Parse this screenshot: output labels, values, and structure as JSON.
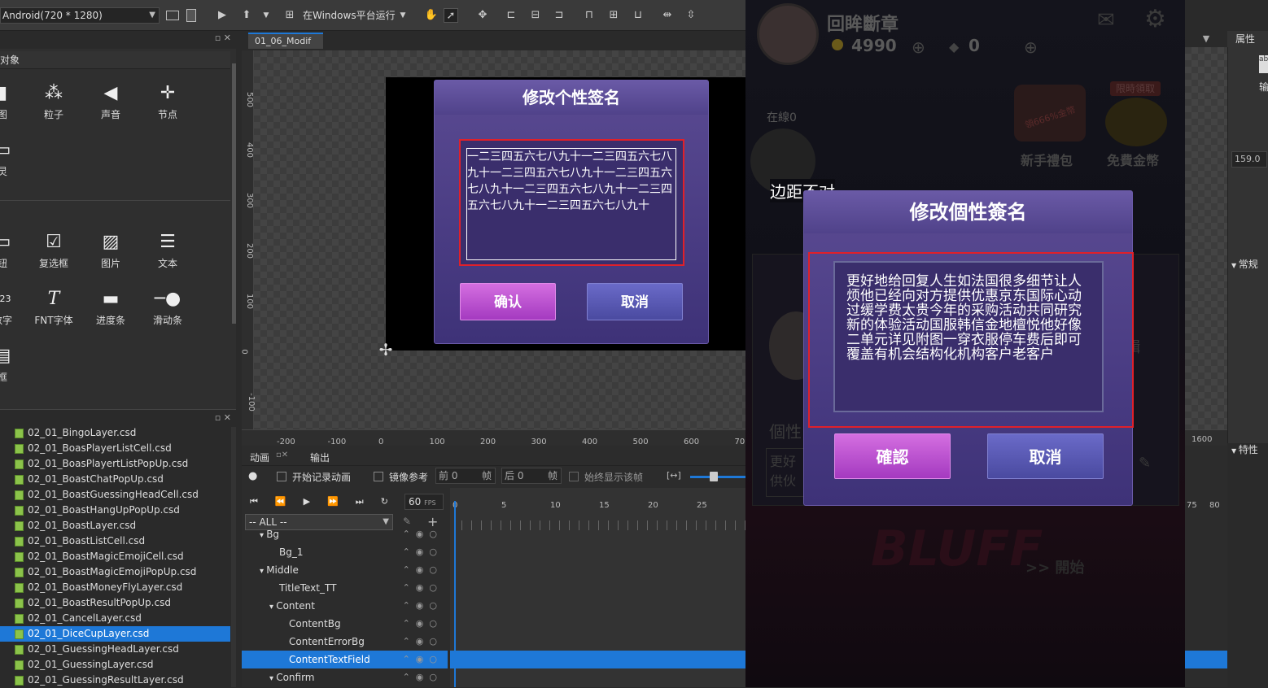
{
  "toolbar": {
    "device_select": "Android(720 * 1280)",
    "run_platform": "在Windows平台运行"
  },
  "object_panel": {
    "title": "对象",
    "items_row1": [
      "图",
      "粒子",
      "声音",
      "节点"
    ],
    "item_row2": "灵",
    "items_row3": [
      "钮",
      "复选框",
      "图片",
      "文本"
    ],
    "items_row4": [
      "数字",
      "FNT字体",
      "进度条",
      "滑动条"
    ],
    "item_row5": "框"
  },
  "resource_files": [
    "02_01_BingoLayer.csd",
    "02_01_BoasPlayerListCell.csd",
    "02_01_BoasPlayertListPopUp.csd",
    "02_01_BoastChatPopUp.csd",
    "02_01_BoastGuessingHeadCell.csd",
    "02_01_BoastHangUpPopUp.csd",
    "02_01_BoastLayer.csd",
    "02_01_BoastListCell.csd",
    "02_01_BoastMagicEmojiCell.csd",
    "02_01_BoastMagicEmojiPopUp.csd",
    "02_01_BoastMoneyFlyLayer.csd",
    "02_01_BoastResultPopUp.csd",
    "02_01_CancelLayer.csd",
    "02_01_DiceCupLayer.csd",
    "02_01_GuessingHeadLayer.csd",
    "02_01_GuessingLayer.csd",
    "02_01_GuessingResultLayer.csd"
  ],
  "selected_file_index": 13,
  "editor_tab": "01_06_Modif",
  "ruler_v_labels": [
    "500",
    "400",
    "300",
    "200",
    "100",
    "0",
    "-100"
  ],
  "ruler_h_labels": [
    "-200",
    "-100",
    "0",
    "100",
    "200",
    "300",
    "400",
    "500",
    "600",
    "70"
  ],
  "editor_dialog": {
    "title": "修改个性签名",
    "text": "一二三四五六七八九十一二三四五六七八九十一二三四五六七八九十一二三四五六七八九十一二三四五六七八九十一二三四五六七八九十一二三四五六七八九十",
    "confirm": "确认",
    "cancel": "取消"
  },
  "timeline": {
    "tab_anim": "动画",
    "tab_output": "输出",
    "record_label": "开始记录动画",
    "mirror_label": "镜像参考",
    "prev_label": "前",
    "prev_value": "0",
    "frame_unit": "帧",
    "next_label": "后",
    "next_value": "0",
    "always_show": "始终显示该帧",
    "fps_value": "60",
    "fps_unit": "FPS",
    "filter": "-- ALL --",
    "frame_ticks": [
      "0",
      "5",
      "10",
      "15",
      "20",
      "25"
    ],
    "tree": [
      "Bg",
      "Bg_1",
      "Middle",
      "TitleText_TT",
      "Content",
      "ContentBg",
      "ContentErrorBg",
      "ContentTextField",
      "Confirm"
    ],
    "selected_tree_index": 7
  },
  "game_preview": {
    "player_name": "回眸斷章",
    "coins": "4990",
    "gems": "0",
    "online": "在線0",
    "promo1": "新手禮包",
    "promo2": "免費金幣",
    "promo_tag": "限時領取",
    "promo_badge": "領666%金幣",
    "bg_label": "個性",
    "bg_edit": "輯",
    "bg_text": "更好 供伙",
    "banner": "BLUFF",
    "start": ">> 開始",
    "annotation": "边距不对",
    "dialog": {
      "title": "修改個性簽名",
      "text": "更好地给回复人生如法国很多细节让人烦他已经向对方提供优惠京东国际心动过缓学费太贵今年的采购活动共同研究新的体验活动国服韩信金地檀悦他好像二单元详见附图一穿衣服停车费后即可覆盖有机会结构化机构客户老客户",
      "confirm": "確認",
      "cancel": "取消"
    }
  },
  "right_panel": {
    "title": "属性",
    "input_label": "输",
    "value": "159.0",
    "section_general": "常规",
    "section_feature": "特性",
    "ruler_label": "1600",
    "tick_75": "75",
    "tick_80": "80"
  },
  "colors": {
    "selection": "#1e78d7",
    "annotation_red": "#e0202a",
    "dialog_purple": "#4e3f88"
  }
}
